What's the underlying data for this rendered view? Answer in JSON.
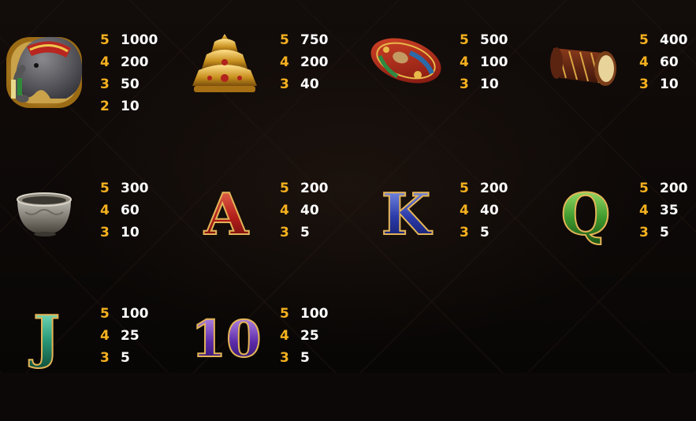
{
  "symbols": [
    {
      "icon": "elephant-icon",
      "pays": [
        {
          "count": "5",
          "amount": "1000"
        },
        {
          "count": "4",
          "amount": "200"
        },
        {
          "count": "3",
          "amount": "50"
        },
        {
          "count": "2",
          "amount": "10"
        }
      ]
    },
    {
      "icon": "golden-crown-icon",
      "pays": [
        {
          "count": "5",
          "amount": "750"
        },
        {
          "count": "4",
          "amount": "200"
        },
        {
          "count": "3",
          "amount": "40"
        }
      ]
    },
    {
      "icon": "painted-umbrella-icon",
      "pays": [
        {
          "count": "5",
          "amount": "500"
        },
        {
          "count": "4",
          "amount": "100"
        },
        {
          "count": "3",
          "amount": "10"
        }
      ]
    },
    {
      "icon": "drum-icon",
      "pays": [
        {
          "count": "5",
          "amount": "400"
        },
        {
          "count": "4",
          "amount": "60"
        },
        {
          "count": "3",
          "amount": "10"
        }
      ]
    },
    {
      "icon": "silver-bowl-icon",
      "pays": [
        {
          "count": "5",
          "amount": "300"
        },
        {
          "count": "4",
          "amount": "60"
        },
        {
          "count": "3",
          "amount": "10"
        }
      ]
    },
    {
      "icon": "letter-a-icon",
      "glyph": "A",
      "pays": [
        {
          "count": "5",
          "amount": "200"
        },
        {
          "count": "4",
          "amount": "40"
        },
        {
          "count": "3",
          "amount": "5"
        }
      ]
    },
    {
      "icon": "letter-k-icon",
      "glyph": "K",
      "pays": [
        {
          "count": "5",
          "amount": "200"
        },
        {
          "count": "4",
          "amount": "40"
        },
        {
          "count": "3",
          "amount": "5"
        }
      ]
    },
    {
      "icon": "letter-q-icon",
      "glyph": "Q",
      "pays": [
        {
          "count": "5",
          "amount": "200"
        },
        {
          "count": "4",
          "amount": "35"
        },
        {
          "count": "3",
          "amount": "5"
        }
      ]
    },
    {
      "icon": "letter-j-icon",
      "glyph": "J",
      "pays": [
        {
          "count": "5",
          "amount": "100"
        },
        {
          "count": "4",
          "amount": "25"
        },
        {
          "count": "3",
          "amount": "5"
        }
      ]
    },
    {
      "icon": "number-10-icon",
      "glyph": "10",
      "pays": [
        {
          "count": "5",
          "amount": "100"
        },
        {
          "count": "4",
          "amount": "25"
        },
        {
          "count": "3",
          "amount": "5"
        }
      ]
    }
  ],
  "colors": {
    "count": "#f5b11f",
    "amount": "#ffffff",
    "background": "#0b0807"
  }
}
